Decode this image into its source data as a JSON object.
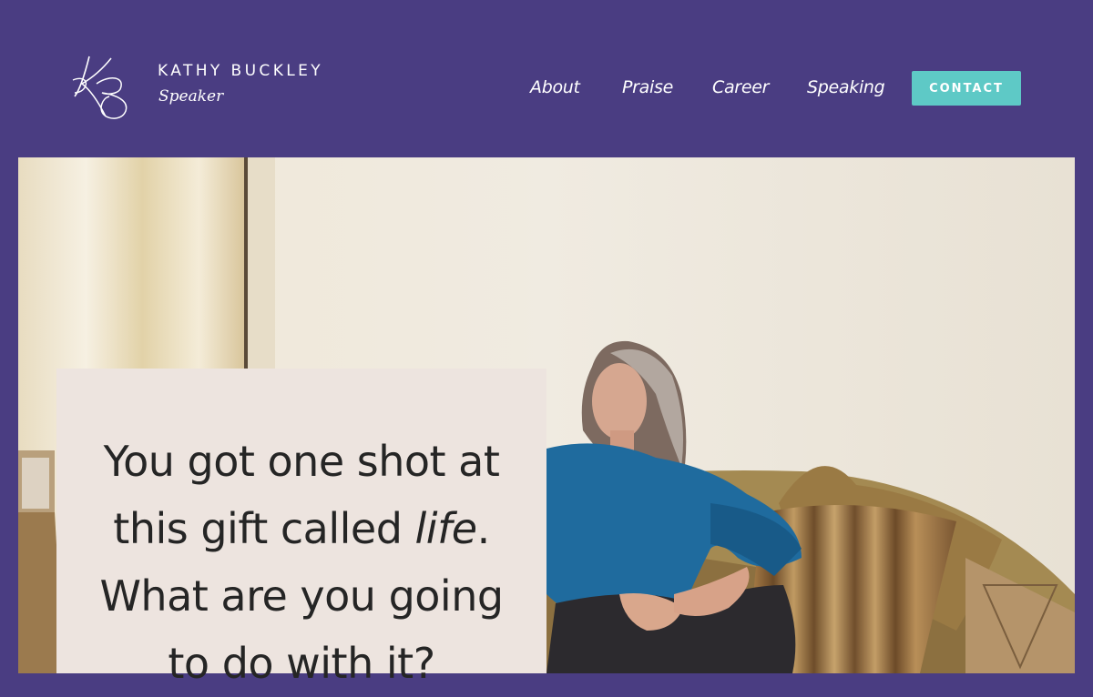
{
  "brand": {
    "name": "KATHY BUCKLEY",
    "tagline": "Speaker",
    "logo_icon": "kb-monogram-icon"
  },
  "nav": {
    "items": [
      {
        "label": "About"
      },
      {
        "label": "Praise"
      },
      {
        "label": "Career"
      },
      {
        "label": "Speaking"
      }
    ],
    "contact_label": "CONTACT"
  },
  "hero": {
    "image": "woman-on-sofa-photo",
    "quote": {
      "line1": "You got one shot at",
      "line2_prefix": "this gift called ",
      "line2_em": "life",
      "line2_suffix": ".",
      "line3": "What are you going",
      "line4": "to do with it?"
    }
  },
  "colors": {
    "header_bg": "#4a3d82",
    "contact_button": "#5ec9c6",
    "quote_box": "#ede4df"
  }
}
